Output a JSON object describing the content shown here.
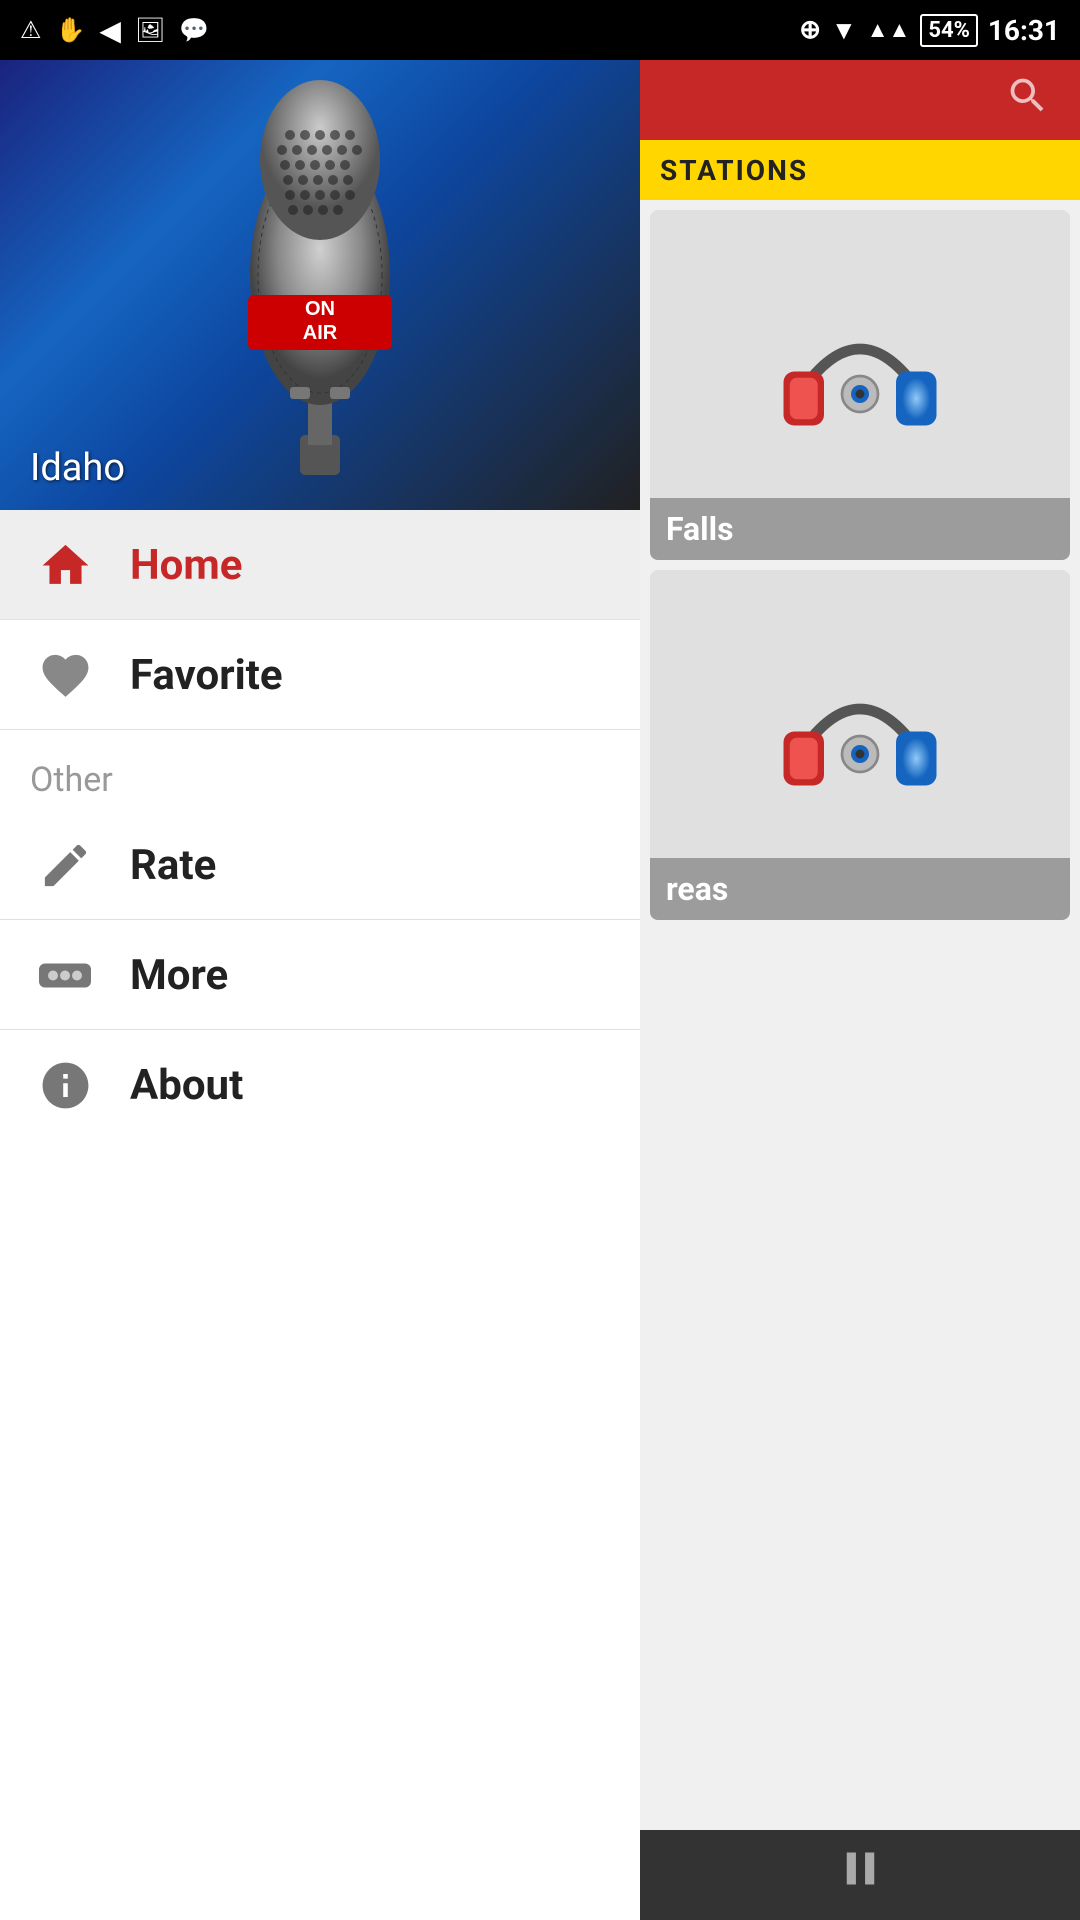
{
  "statusBar": {
    "time": "16:31",
    "battery": "54%"
  },
  "hero": {
    "label": "Idaho",
    "onAirText": "ON AIR"
  },
  "menu": {
    "homeLabel": "Home",
    "favoriteLabel": "Favorite",
    "otherSectionLabel": "Other",
    "rateLabel": "Rate",
    "moreLabel": "More",
    "aboutLabel": "About"
  },
  "rightPanel": {
    "searchIconLabel": "search",
    "stationsLabel": "STATIONS",
    "stations": [
      {
        "name": "Falls",
        "id": "station-1"
      },
      {
        "name": "reas",
        "id": "station-2"
      }
    ]
  },
  "player": {
    "pauseLabel": "⏸"
  }
}
